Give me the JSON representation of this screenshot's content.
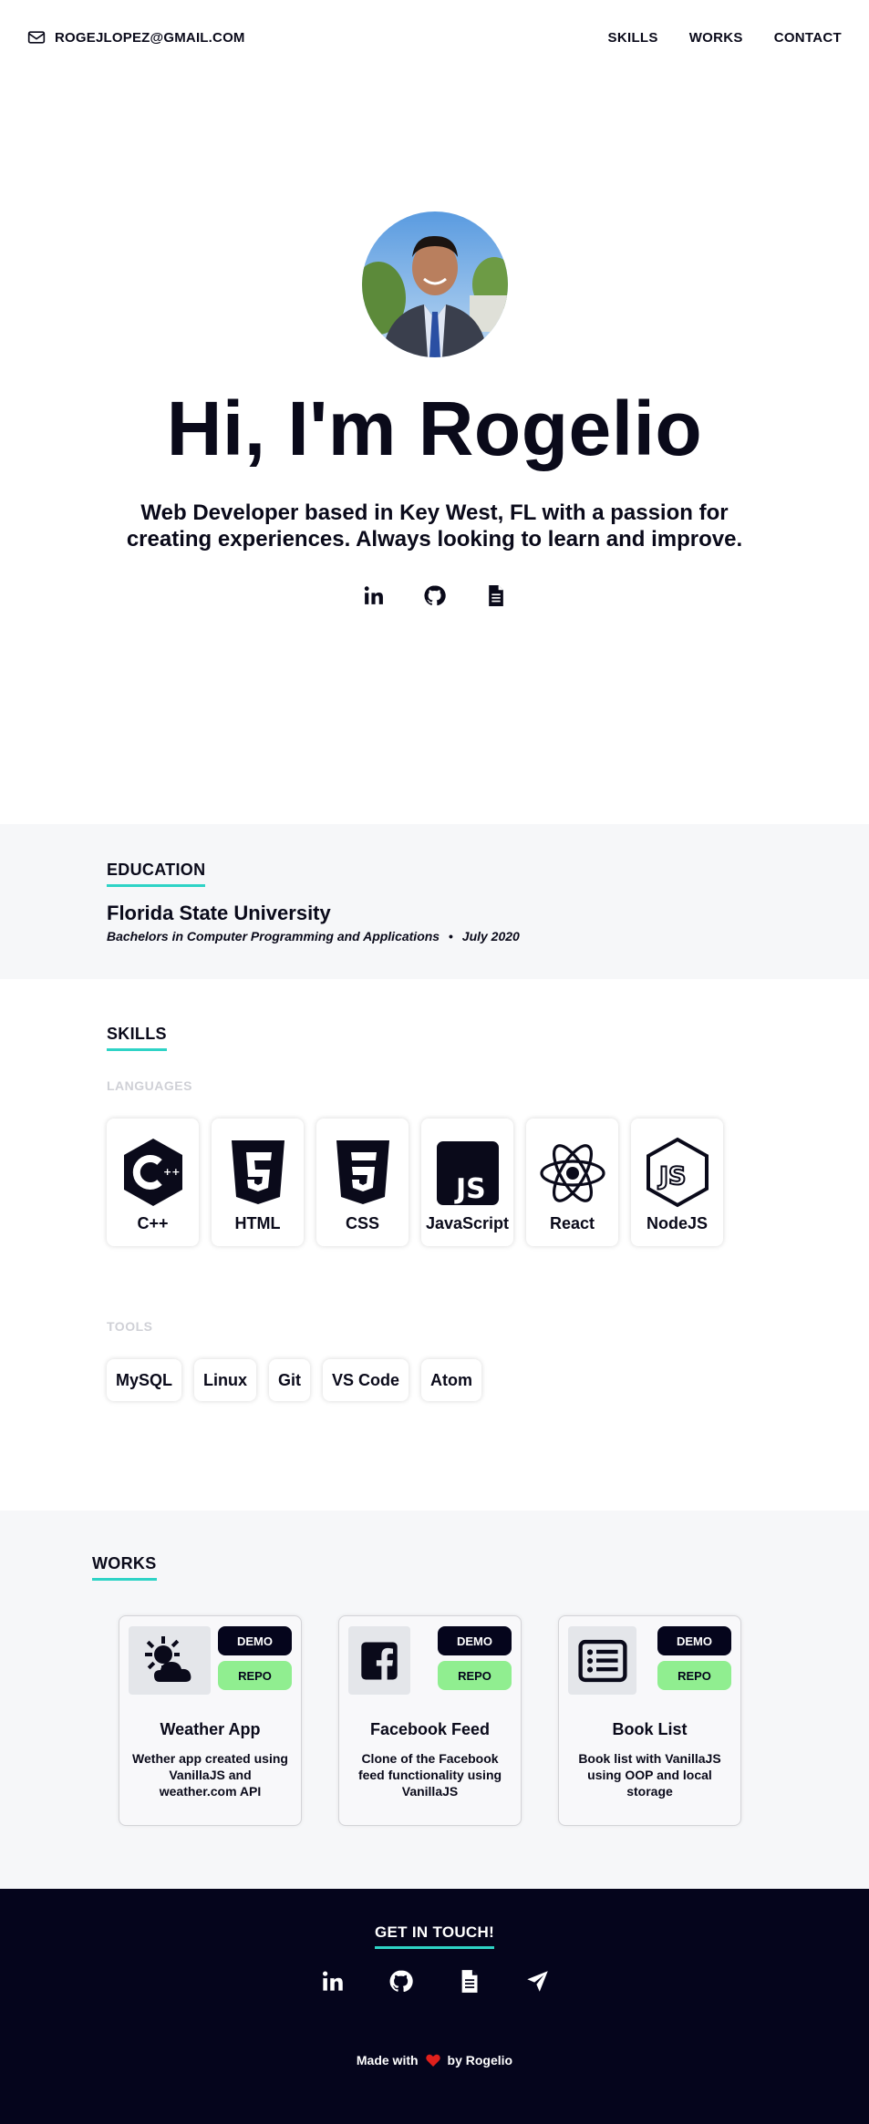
{
  "nav": {
    "email": "ROGEJLOPEZ@GMAIL.COM",
    "links": [
      "SKILLS",
      "WORKS",
      "CONTACT"
    ]
  },
  "hero": {
    "title": "Hi, I'm Rogelio",
    "subtitle": "Web Developer based in Key West, FL with a passion for creating experiences. Always looking to learn and improve.",
    "socials": [
      "linkedin-icon",
      "github-icon",
      "document-icon"
    ]
  },
  "education": {
    "heading": "EDUCATION",
    "school": "Florida State University",
    "degree": "Bachelors in Computer Programming and Applications",
    "separator": "•",
    "date": "July 2020"
  },
  "skills": {
    "heading": "SKILLS",
    "languages_heading": "LANGUAGES",
    "languages": [
      {
        "label": "C++",
        "icon": "cplusplus-icon"
      },
      {
        "label": "HTML",
        "icon": "html5-icon"
      },
      {
        "label": "CSS",
        "icon": "css3-icon"
      },
      {
        "label": "JavaScript",
        "icon": "javascript-icon"
      },
      {
        "label": "React",
        "icon": "react-icon"
      },
      {
        "label": "NodeJS",
        "icon": "nodejs-icon"
      }
    ],
    "tools_heading": "TOOLS",
    "tools": [
      "MySQL",
      "Linux",
      "Git",
      "VS Code",
      "Atom"
    ]
  },
  "works": {
    "heading": "WORKS",
    "demo_label": "DEMO",
    "repo_label": "REPO",
    "projects": [
      {
        "title": "Weather App",
        "description": "Wether app created using VanillaJS and weather.com API",
        "icon": "weather-icon"
      },
      {
        "title": "Facebook Feed",
        "description": "Clone of the Facebook feed functionality using VanillaJS",
        "icon": "facebook-icon"
      },
      {
        "title": "Book List",
        "description": "Book list with VanillaJS using OOP and local storage",
        "icon": "list-icon"
      }
    ]
  },
  "footer": {
    "heading": "GET IN TOUCH!",
    "socials": [
      "linkedin-icon",
      "github-icon",
      "document-icon",
      "send-icon"
    ],
    "made_with_prefix": "Made with",
    "made_with_suffix": "by Rogelio",
    "accent_color": "#2ed3c6",
    "dark_color": "#05051c",
    "heart_color": "#e0201c"
  }
}
